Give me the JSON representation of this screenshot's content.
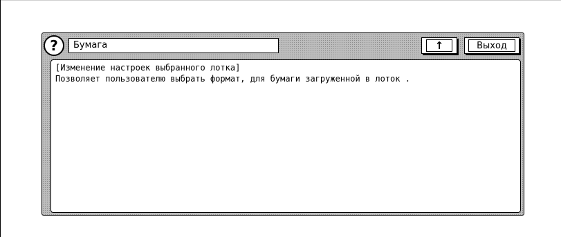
{
  "window": {
    "title": "Бумага",
    "help_label": "?",
    "back_label": "↑",
    "exit_label": "Выход"
  },
  "content": {
    "heading": "[Изменение настроек выбранного лотка]",
    "description": "Позволяет пользователю выбрать формат, для бумаги загруженной в лоток ."
  }
}
